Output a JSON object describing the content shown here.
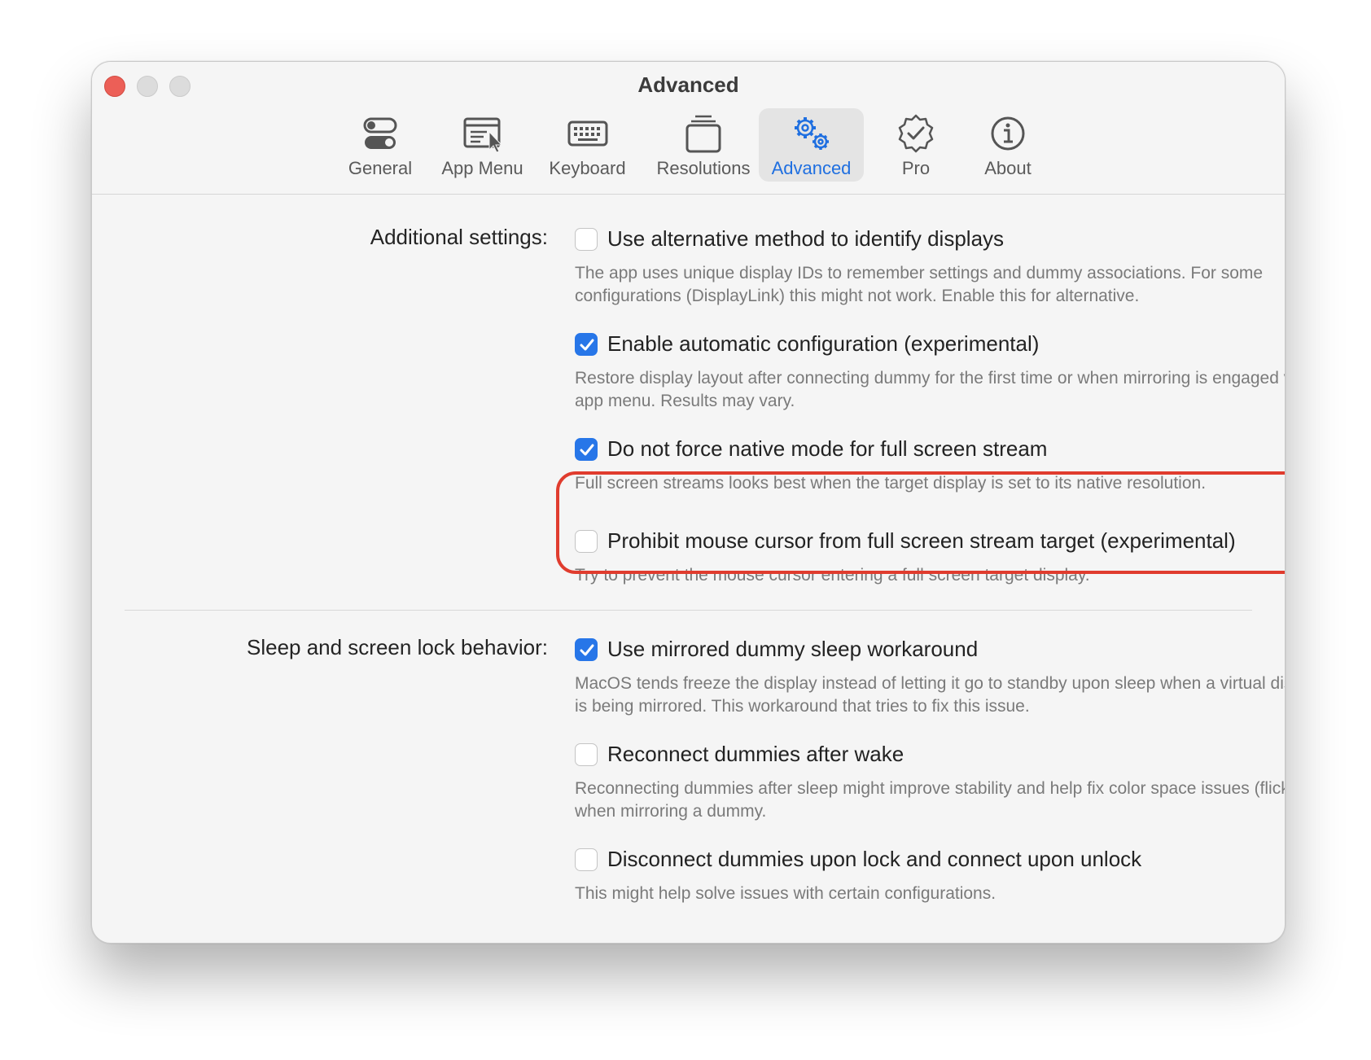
{
  "window": {
    "title": "Advanced"
  },
  "toolbar": {
    "items": [
      {
        "label": "General",
        "icon": "switches-icon"
      },
      {
        "label": "App Menu",
        "icon": "app-menu-icon"
      },
      {
        "label": "Keyboard",
        "icon": "keyboard-icon"
      },
      {
        "label": "Resolutions",
        "icon": "resolutions-icon"
      },
      {
        "label": "Advanced",
        "icon": "gears-icon",
        "selected": true
      },
      {
        "label": "Pro",
        "icon": "verified-badge-icon"
      },
      {
        "label": "About",
        "icon": "info-icon"
      }
    ]
  },
  "sections": {
    "additional": {
      "label": "Additional settings:",
      "options": [
        {
          "label": "Use alternative method to identify displays",
          "checked": false,
          "description": "The app uses unique display IDs to remember settings and dummy associations. For some configurations (DisplayLink) this might not work. Enable this for alternative."
        },
        {
          "label": "Enable automatic configuration (experimental)",
          "checked": true,
          "description": "Restore display layout after connecting dummy for the first time or when mirroring is engaged via the app menu. Results may vary."
        },
        {
          "label": "Do not force native mode for full screen stream",
          "checked": true,
          "description": "Full screen streams looks best when the target display is set to its native resolution."
        },
        {
          "label": "Prohibit mouse cursor from full screen stream target (experimental)",
          "checked": false,
          "description": "Try to prevent the mouse cursor entering a full screen target display."
        }
      ]
    },
    "sleep": {
      "label": "Sleep and screen lock behavior:",
      "options": [
        {
          "label": "Use mirrored dummy sleep workaround",
          "checked": true,
          "description": "MacOS tends freeze the display instead of letting it go to standby upon sleep when a virtual display is being mirrored. This workaround that tries to fix this issue."
        },
        {
          "label": "Reconnect dummies after wake",
          "checked": false,
          "description": "Reconnecting dummies after sleep might improve stability and help fix color space issues (flickering) when mirroring a dummy."
        },
        {
          "label": "Disconnect dummies upon lock and connect upon unlock",
          "checked": false,
          "description": "This might help solve issues with certain configurations."
        }
      ]
    }
  },
  "colors": {
    "accent": "#2776e8",
    "highlight": "#e03c2e",
    "close": "#ec5f57"
  }
}
